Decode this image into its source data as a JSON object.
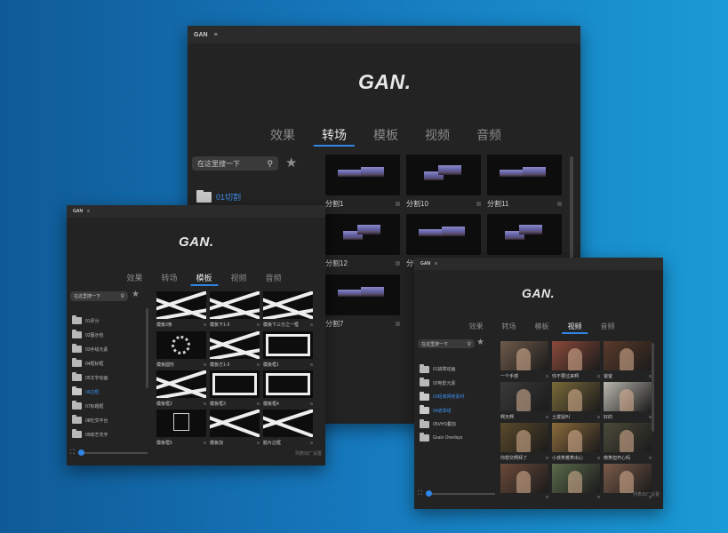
{
  "brand": "GAN.",
  "title_short": "GAN",
  "menu_glyph": "≡",
  "tabs": [
    "效果",
    "转场",
    "模板",
    "视频",
    "音频"
  ],
  "search_placeholder": "在这里搜一下",
  "footer_hint": "列表出厂设置",
  "back_window": {
    "active_tab": "转场",
    "folders": [
      {
        "label": "01切割",
        "active": true
      }
    ],
    "items": [
      "分割1",
      "分割10",
      "分割11",
      "分割12",
      "分割2",
      "分割4",
      "分割7"
    ]
  },
  "left_window": {
    "active_tab": "模板",
    "folders": [
      {
        "label": "01评分",
        "active": false
      },
      {
        "label": "02图示包",
        "active": false
      },
      {
        "label": "03手绘元素",
        "active": false
      },
      {
        "label": "04框标框",
        "active": false
      },
      {
        "label": "05文字动画",
        "active": false
      },
      {
        "label": "06边框",
        "active": true
      },
      {
        "label": "07标题框",
        "active": false
      },
      {
        "label": "08社交平台",
        "active": false
      },
      {
        "label": "09综艺花字",
        "active": false
      }
    ],
    "items": [
      "模板3条",
      "模板下1-3",
      "模板下三分之一框",
      "模板圆形",
      "模板方1-3",
      "模板框1",
      "模板框2",
      "模板框3",
      "模板框4",
      "模板框5",
      "模板加",
      "胶片边框"
    ]
  },
  "right_window": {
    "active_tab": "视频",
    "folders": [
      {
        "label": "01故障动画",
        "active": false
      },
      {
        "label": "02电影元素",
        "active": false
      },
      {
        "label": "03经典网络素材",
        "active": true
      },
      {
        "label": "04遮罩组",
        "active": true
      },
      {
        "label": "05VHS叠加",
        "active": false
      },
      {
        "label": "Grain Overlays",
        "active": false
      }
    ],
    "items": [
      "一个手感",
      "你不要过来啊",
      "爸爸",
      "啊天啊",
      "土拨鼠叫",
      "好的",
      "你想交啊拜了",
      "小孩笑着笑出心",
      "微笑但开心吗",
      "",
      "",
      ""
    ],
    "thumb_colors": [
      "#6e5a4a",
      "#8a4a3a",
      "#5a3a2a",
      "#3a3a3a",
      "#7a6a3a",
      "#b9b6ae",
      "#5a4a2a",
      "#8a6a3a",
      "#4a4a3a",
      "#6a4a3a",
      "#5a6a4a",
      "#7a5a4a"
    ]
  }
}
